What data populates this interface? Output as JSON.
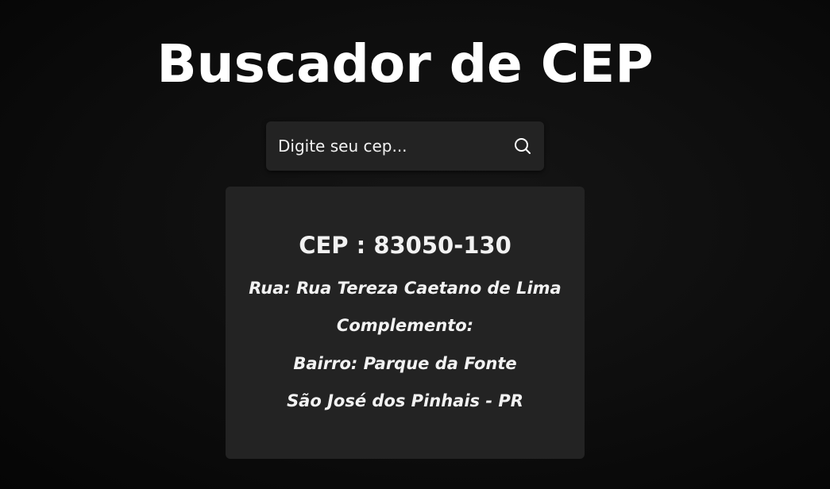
{
  "app": {
    "title": "Buscador de CEP"
  },
  "search": {
    "placeholder": "Digite seu cep...",
    "value": "",
    "button_icon": "search-icon"
  },
  "result": {
    "cep_line": "CEP : 83050-130",
    "rua_line": "Rua: Rua Tereza Caetano de Lima",
    "complemento_line": "Complemento:",
    "bairro_line": "Bairro: Parque da Fonte",
    "cidade_uf_line": "São José dos Pinhais - PR"
  },
  "colors": {
    "background": "#0d0d0d",
    "surface": "#232323",
    "text": "#ffffff"
  }
}
